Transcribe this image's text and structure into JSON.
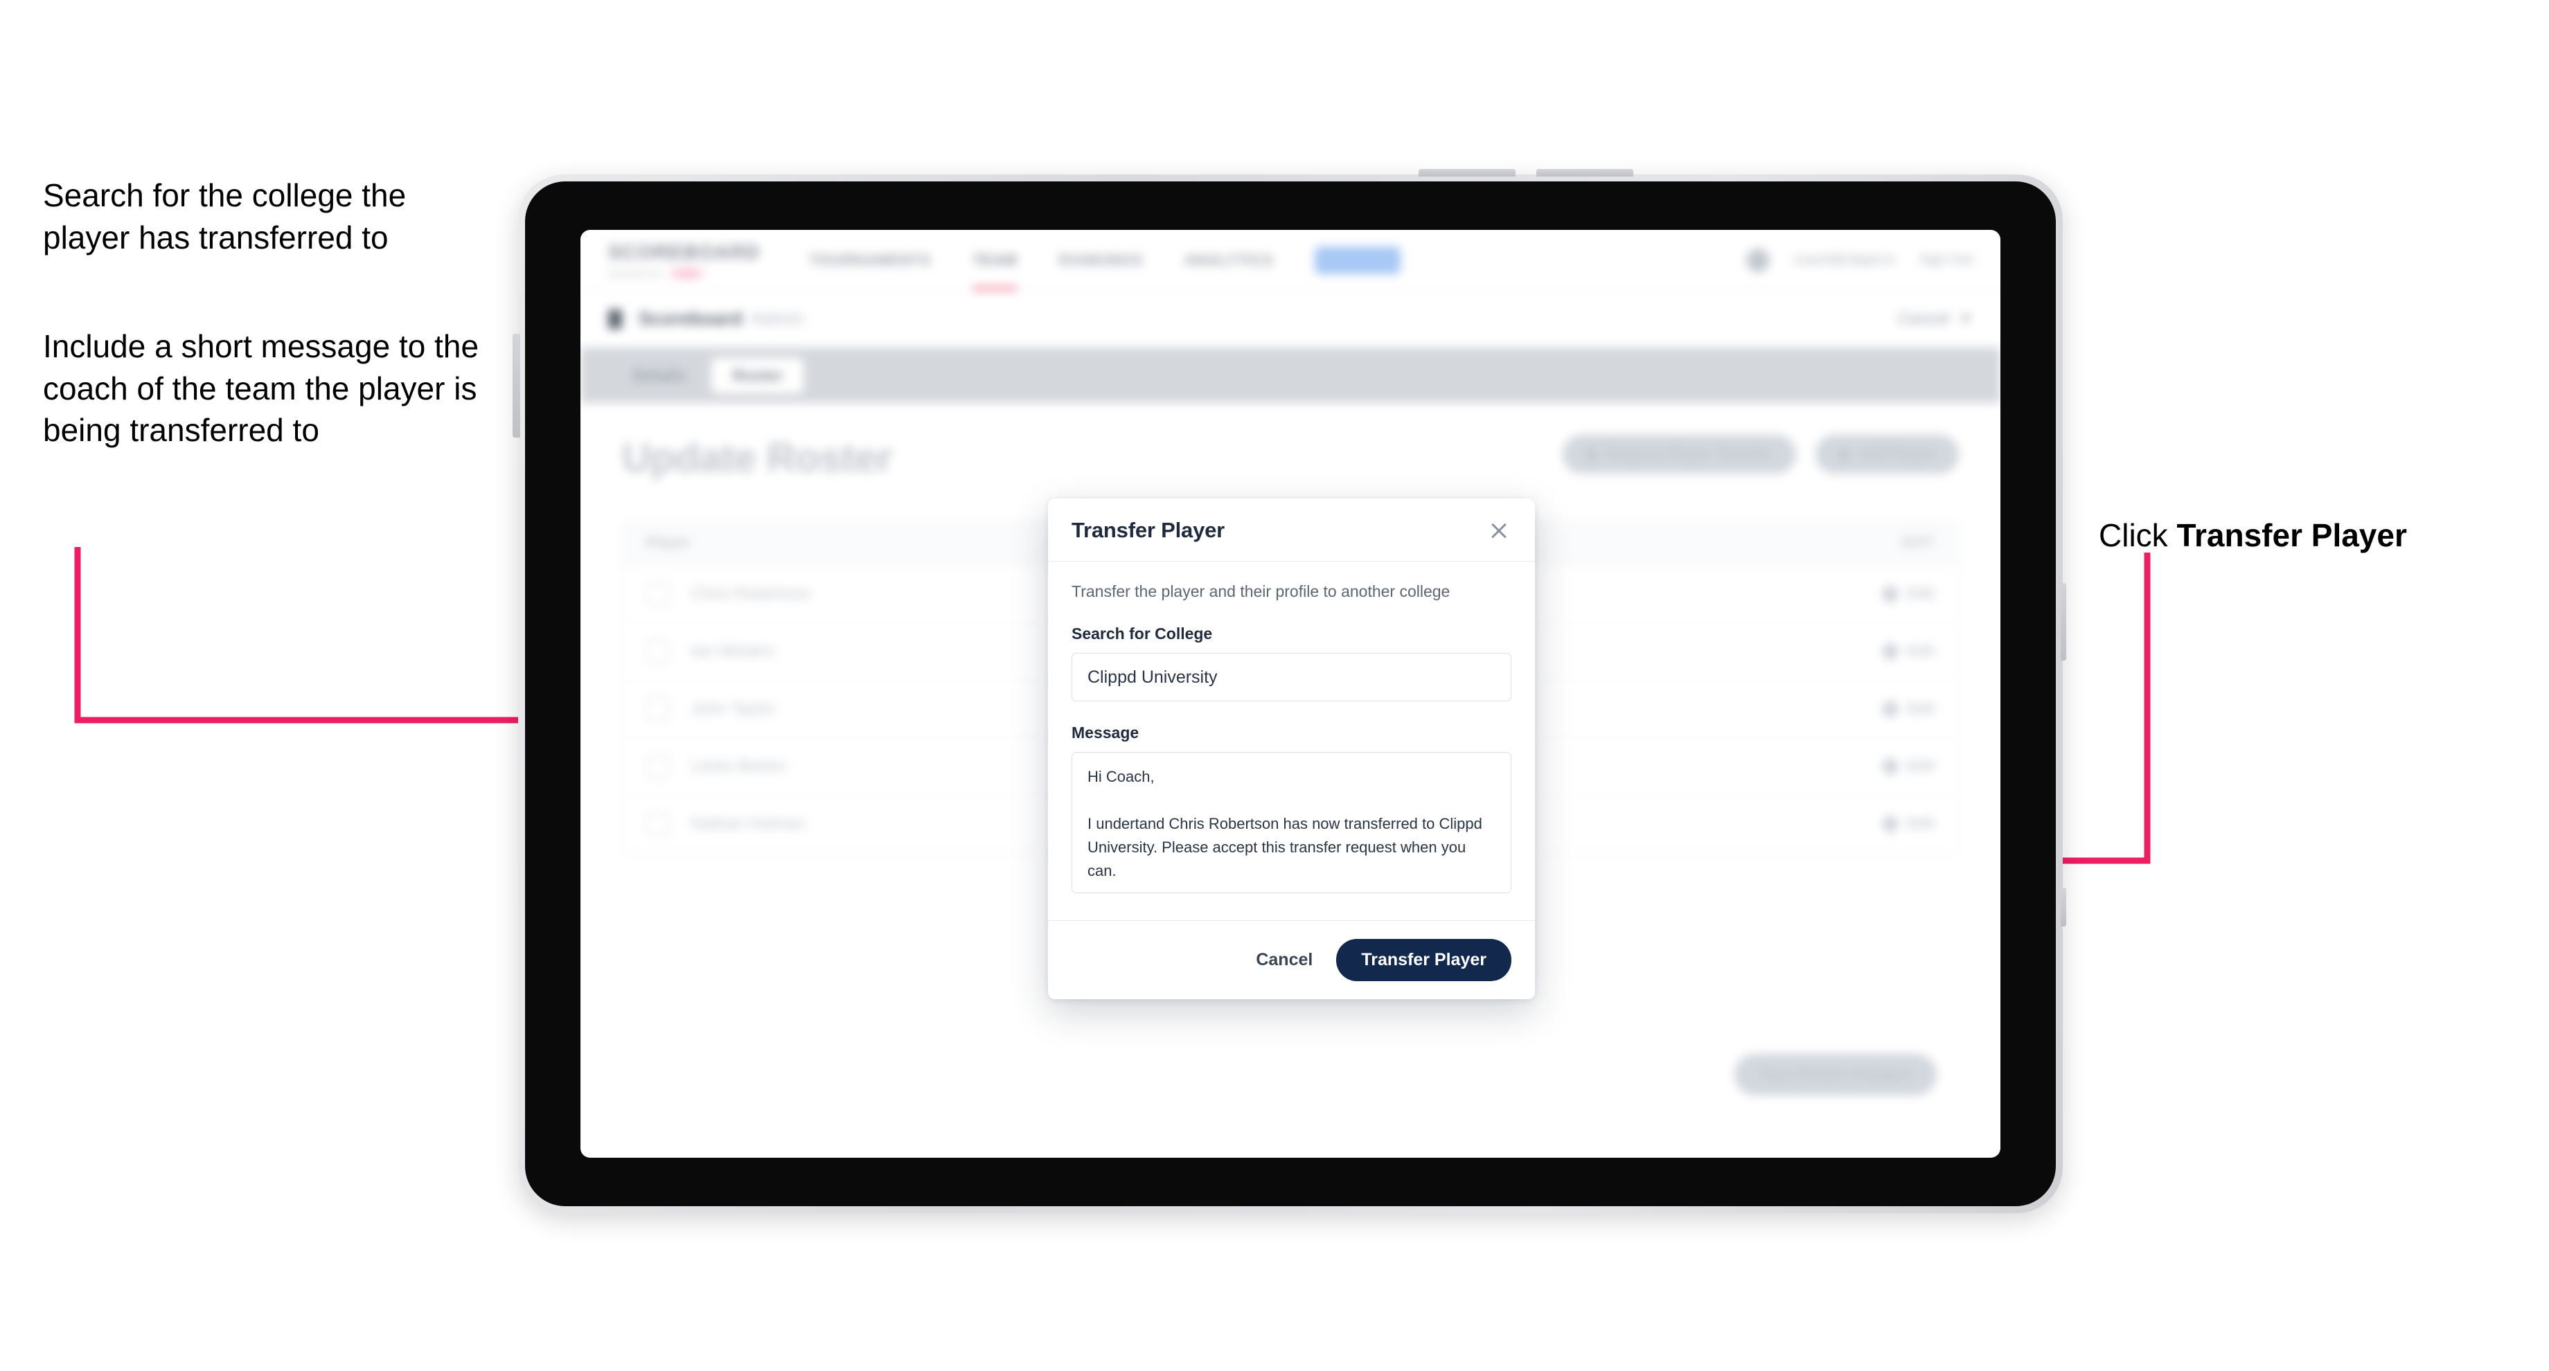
{
  "annotations": {
    "left_1": "Search for the college the player has transferred to",
    "left_2": "Include a short message to the coach of the team the player is being transferred to",
    "right_1_prefix": "Click ",
    "right_1_bold": "Transfer Player"
  },
  "colors": {
    "accent_pink": "#ed1e62",
    "button_navy": "#12284c",
    "tablet_frame": "#0a0a0a"
  },
  "app": {
    "navbar": {
      "logo_main": "SCOREBOARD",
      "logo_sub": "powered by",
      "logo_badge": "clippd",
      "links": [
        {
          "label": "TOURNAMENTS"
        },
        {
          "label": "TEAM"
        },
        {
          "label": "RANKINGS"
        },
        {
          "label": "ANALYTICS"
        }
      ],
      "pill_label": "ADMIN",
      "user_email": "coach@clippd.io",
      "sign_out": "Sign Out"
    },
    "breadcrumb": {
      "title": "Scoreboard",
      "subtitle": "Admin",
      "cancel_label": "Cancel",
      "cancel_icon": "close-icon"
    },
    "tabs": [
      {
        "label": "Details",
        "active": false
      },
      {
        "label": "Roster",
        "active": true
      }
    ],
    "page": {
      "title": "Update Roster",
      "actions": [
        {
          "label": "Request Player Transfer",
          "icon": "transfer-icon"
        },
        {
          "label": "Add Player",
          "icon": "plus-icon"
        }
      ],
      "bottom_action": "Save Roster Changes"
    },
    "roster": {
      "header_left": "Player",
      "header_right": "EDIT",
      "rows": [
        {
          "name": "Chris Robertson",
          "action": "Edit"
        },
        {
          "name": "Ian Winters",
          "action": "Edit"
        },
        {
          "name": "John Taylor",
          "action": "Edit"
        },
        {
          "name": "Lewis Barton",
          "action": "Edit"
        },
        {
          "name": "Nathan Holmes",
          "action": "Edit"
        }
      ]
    }
  },
  "modal": {
    "title": "Transfer Player",
    "close_icon": "close-icon",
    "description": "Transfer the player and their profile to another college",
    "college_label": "Search for College",
    "college_value": "Clippd University",
    "college_placeholder": "Search for College",
    "message_label": "Message",
    "message_value": "Hi Coach,\n\nI undertand Chris Robertson has now transferred to Clippd University. Please accept this transfer request when you can.",
    "message_placeholder": "Message",
    "cancel_label": "Cancel",
    "submit_label": "Transfer Player"
  }
}
